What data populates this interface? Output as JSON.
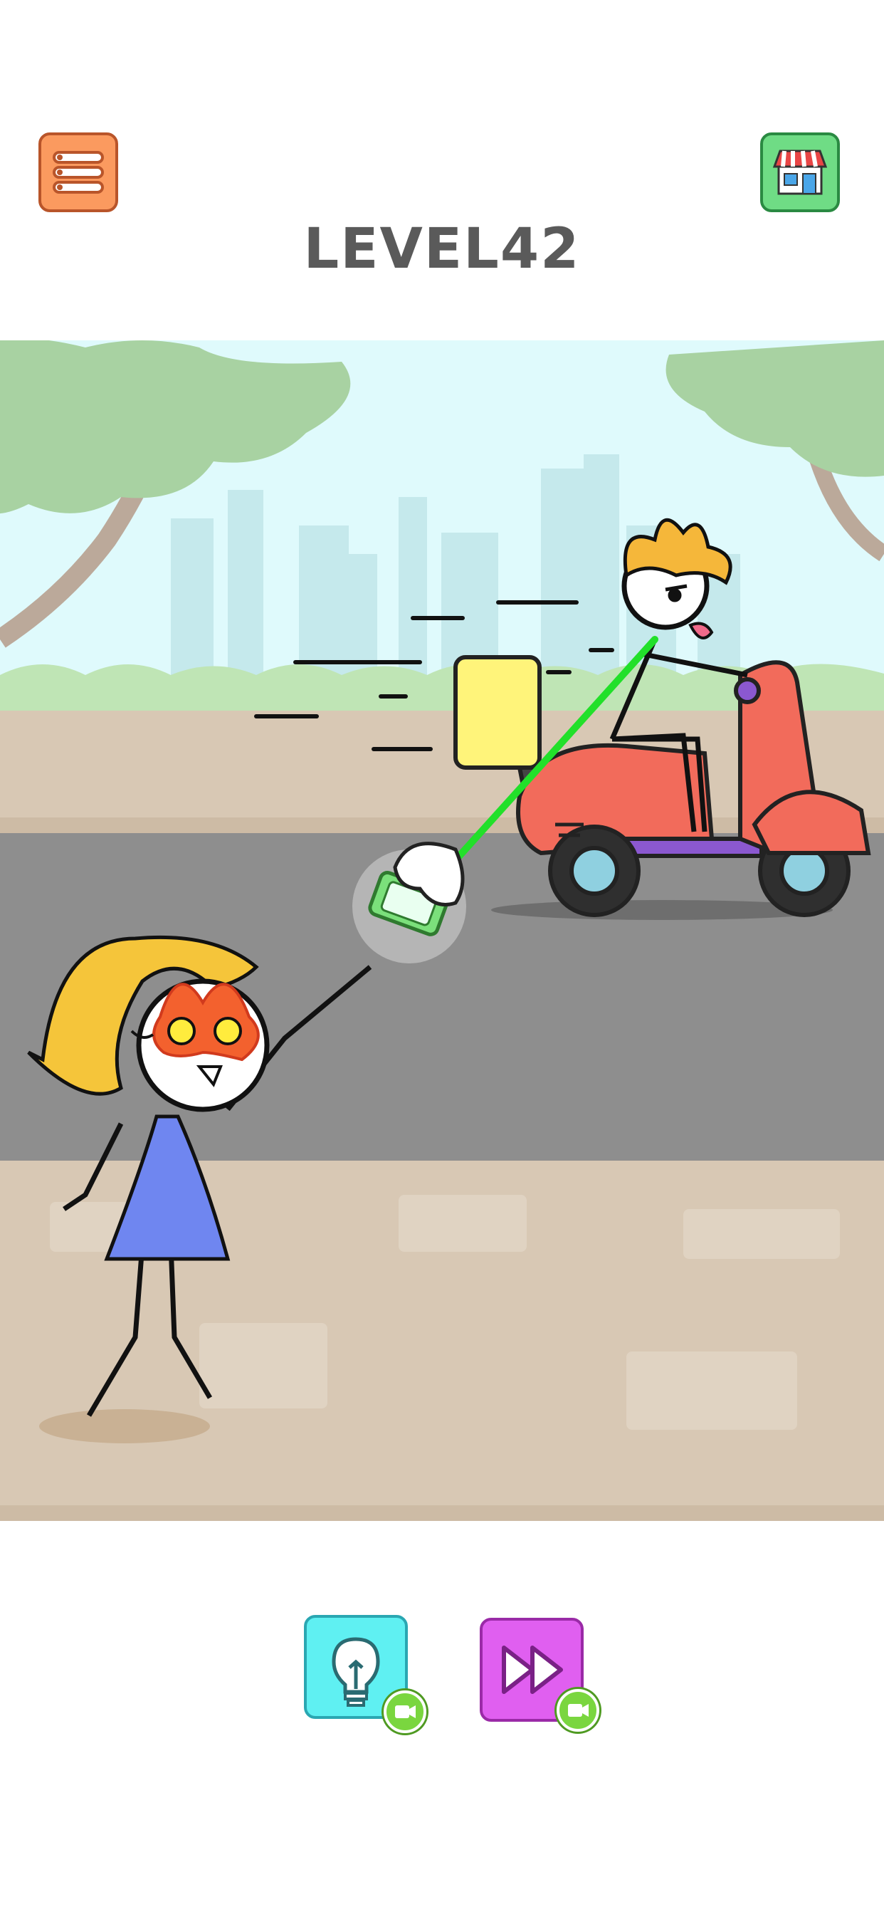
{
  "header": {
    "level_word": "LEVEL",
    "level_number": "42"
  },
  "buttons": {
    "menu_icon": "list-icon",
    "shop_icon": "shop-icon",
    "hint_icon": "lightbulb-icon",
    "skip_icon": "fast-forward-icon",
    "video_badge_icon": "video-camera-icon"
  },
  "colors": {
    "menu": "#fb9a5f",
    "shop": "#6fdc85",
    "hint": "#5ff0f2",
    "skip": "#e05ff0",
    "laser": "#22e02a",
    "scooter": "#f26b5b",
    "dress": "#6f86f0"
  }
}
